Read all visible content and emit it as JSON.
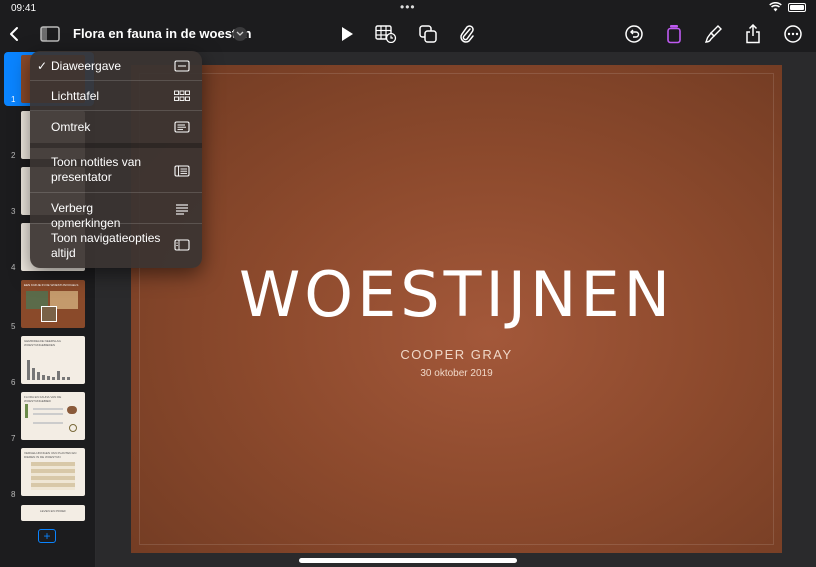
{
  "status": {
    "time": "09:41",
    "dots": "•••"
  },
  "toolbar": {
    "back_icon": "chevron-left-icon",
    "sidebar_icon": "sidebar-icon",
    "title": "Flora en fauna in de woestijn",
    "title_menu_icon": "chevron-down-icon",
    "center_icons": [
      "play-icon",
      "table-icon",
      "shapes-icon",
      "paperclip-icon"
    ],
    "right_icons": [
      "undo-icon",
      "format-icon",
      "paintbrush-icon",
      "share-icon",
      "more-icon"
    ],
    "accent": "#0a84ff"
  },
  "sidebar": {
    "slides": [
      {
        "num": "1",
        "style": "brown",
        "selected": true
      },
      {
        "num": "2",
        "style": "light"
      },
      {
        "num": "3",
        "style": "light"
      },
      {
        "num": "4",
        "style": "light"
      },
      {
        "num": "5",
        "style": "brown",
        "caption": "EEN KIJKJE IN DE WOESTIJNVOGELS"
      },
      {
        "num": "6",
        "style": "light",
        "caption": "GEMIDDELDE NEERSLAG WOESTIJNGEBIEDEN"
      },
      {
        "num": "7",
        "style": "light",
        "caption": "FLORA EN FAUNA VAN DE WOESTIJNGEBIED"
      },
      {
        "num": "8",
        "style": "light",
        "caption": "VERGELIJKINGEN VAN PLANTEN EN DIEREN IN DE WOESTIJN"
      },
      {
        "num": "",
        "style": "light",
        "caption": "LEVEN EN PROEF"
      }
    ],
    "add_label": "+"
  },
  "menu": {
    "items": [
      {
        "label": "Diaweergave",
        "checked": true,
        "icon": "single-slide-icon"
      },
      {
        "label": "Lichttafel",
        "icon": "grid-icon"
      },
      {
        "label": "Omtrek",
        "icon": "outline-icon"
      },
      {
        "label": "Toon notities van presentator",
        "icon": "presenter-notes-icon"
      },
      {
        "label": "Verberg opmerkingen",
        "icon": "comments-icon"
      },
      {
        "label": "Toon navigatieopties altijd",
        "icon": "navigator-icon"
      }
    ],
    "checkmark": "✓"
  },
  "slide": {
    "title": "WOESTIJNEN",
    "author": "COOPER GRAY",
    "date": "30 oktober 2019"
  }
}
